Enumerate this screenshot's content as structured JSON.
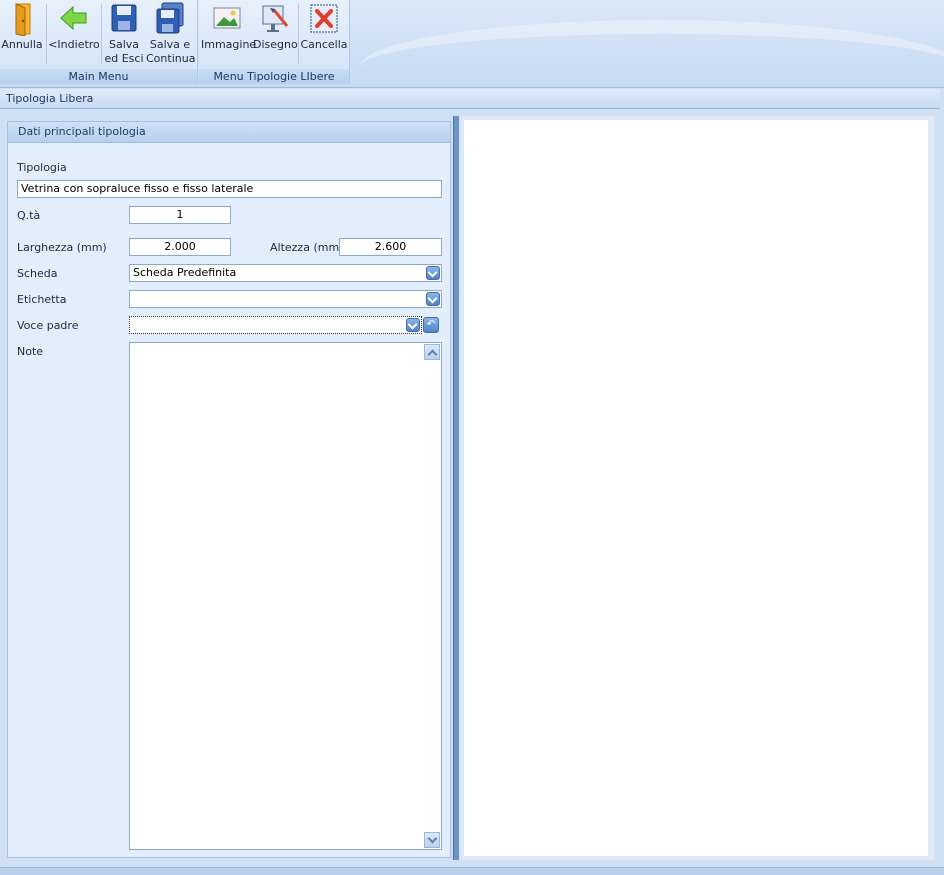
{
  "ribbon": {
    "groups": [
      {
        "label": "Main Menu"
      },
      {
        "label": "Menu Tipologie LIbere"
      }
    ],
    "buttons": {
      "annulla": "Annulla",
      "indietro": "<Indietro",
      "salva_esci": "Salva\ned Esci",
      "salva_continua": "Salva e\nContinua",
      "immagine": "Immagine",
      "disegno": "Disegno",
      "cancella": "Cancella"
    }
  },
  "title": "Tipologia Libera",
  "form": {
    "section_title": "Dati principali tipologia",
    "tipologia_label": "Tipologia",
    "tipologia_value": "Vetrina con sopraluce fisso e fisso laterale",
    "qta_label": "Q.tà",
    "qta_value": "1",
    "larghezza_label": "Larghezza (mm)",
    "larghezza_value": "2.000",
    "altezza_label": "Altezza (mm)",
    "altezza_value": "2.600",
    "scheda_label": "Scheda",
    "scheda_value": "Scheda Predefinita",
    "etichetta_label": "Etichetta",
    "etichetta_value": "",
    "voce_padre_label": "Voce padre",
    "voce_padre_value": "",
    "note_label": "Note",
    "note_value": ""
  },
  "colors": {
    "ribbon_bg": "#dbe8f8",
    "panel_bg": "#e2eefb",
    "splitter": "#6f93c3",
    "accent": "#4f83c9"
  }
}
